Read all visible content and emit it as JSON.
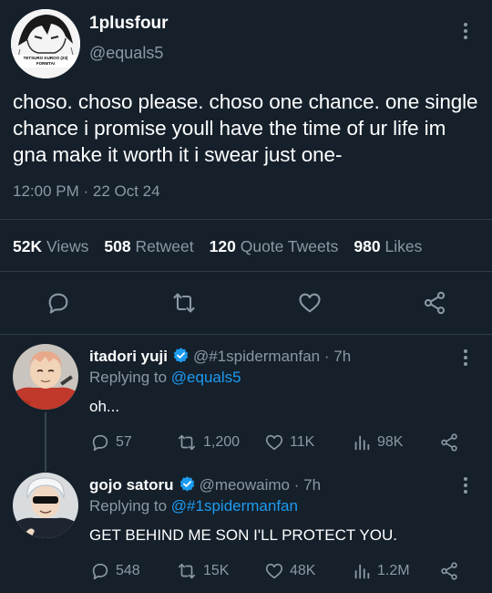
{
  "main_tweet": {
    "display_name": "1plusfour",
    "handle": "@equals5",
    "avatar_text_line1": "TETSURO KUROO (23)",
    "avatar_text_line2": "FORMTAI",
    "text": "choso. choso please. choso one chance. one single chance i promise youll have the time of ur life im gna make it worth it i swear just one-",
    "timestamp": "12:00 PM · 22 Oct 24",
    "stats": {
      "views_count": "52K",
      "views_label": "Views",
      "retweet_count": "508",
      "retweet_label": "Retweet",
      "quote_count": "120",
      "quote_label": "Quote Tweets",
      "likes_count": "980",
      "likes_label": "Likes"
    }
  },
  "replies": [
    {
      "display_name": "itadori yuji",
      "handle": "@#1spidermanfan · 7h",
      "replying_prefix": "Replying to",
      "replying_to": "@equals5",
      "text": "oh...",
      "replies": "57",
      "retweets": "1,200",
      "likes": "11K",
      "views": "98K"
    },
    {
      "display_name": "gojo satoru",
      "handle": "@meowaimo · 7h",
      "replying_prefix": "Replying to",
      "replying_to": "@#1spidermanfan",
      "text": "GET BEHIND ME SON I'LL PROTECT YOU.",
      "replies": "548",
      "retweets": "15K",
      "likes": "48K",
      "views": "1.2M"
    }
  ],
  "colors": {
    "background": "#15202b",
    "text": "#ffffff",
    "secondary": "#8b98a5",
    "accent": "#1d9bf0"
  },
  "icons": {
    "reply": "reply-icon",
    "retweet": "retweet-icon",
    "like": "heart-icon",
    "views": "views-icon",
    "share": "share-icon",
    "verified": "verified-badge-icon",
    "more": "more-dots-icon"
  }
}
